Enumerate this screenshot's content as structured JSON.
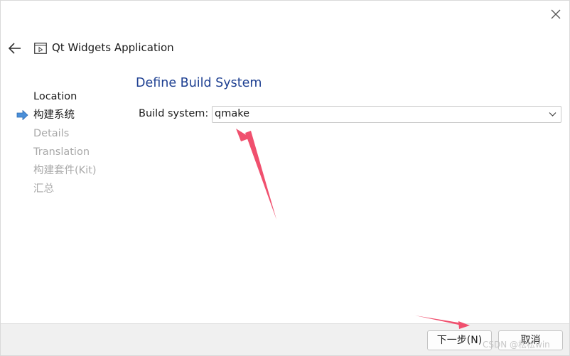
{
  "window": {
    "title": "Qt Widgets Application",
    "close_icon": "close-icon",
    "back_icon": "back-arrow-icon",
    "title_icon": "qt-widgets-app-icon"
  },
  "steps": [
    {
      "label": "Location",
      "state": "done"
    },
    {
      "label": "构建系统",
      "state": "current"
    },
    {
      "label": "Details",
      "state": "pending"
    },
    {
      "label": "Translation",
      "state": "pending"
    },
    {
      "label": "构建套件(Kit)",
      "state": "pending"
    },
    {
      "label": "汇总",
      "state": "pending"
    }
  ],
  "page": {
    "title": "Define Build System",
    "build_system_label": "Build system:",
    "build_system_value": "qmake"
  },
  "footer": {
    "next_label": "下一步(N)",
    "cancel_label": "取消",
    "watermark": "CSDN @松松win"
  },
  "colors": {
    "title_blue": "#1d3f91",
    "annotation_red": "#f0506e",
    "step_arrow": "#4a8fd9",
    "disabled_text": "#a9a9a9"
  }
}
